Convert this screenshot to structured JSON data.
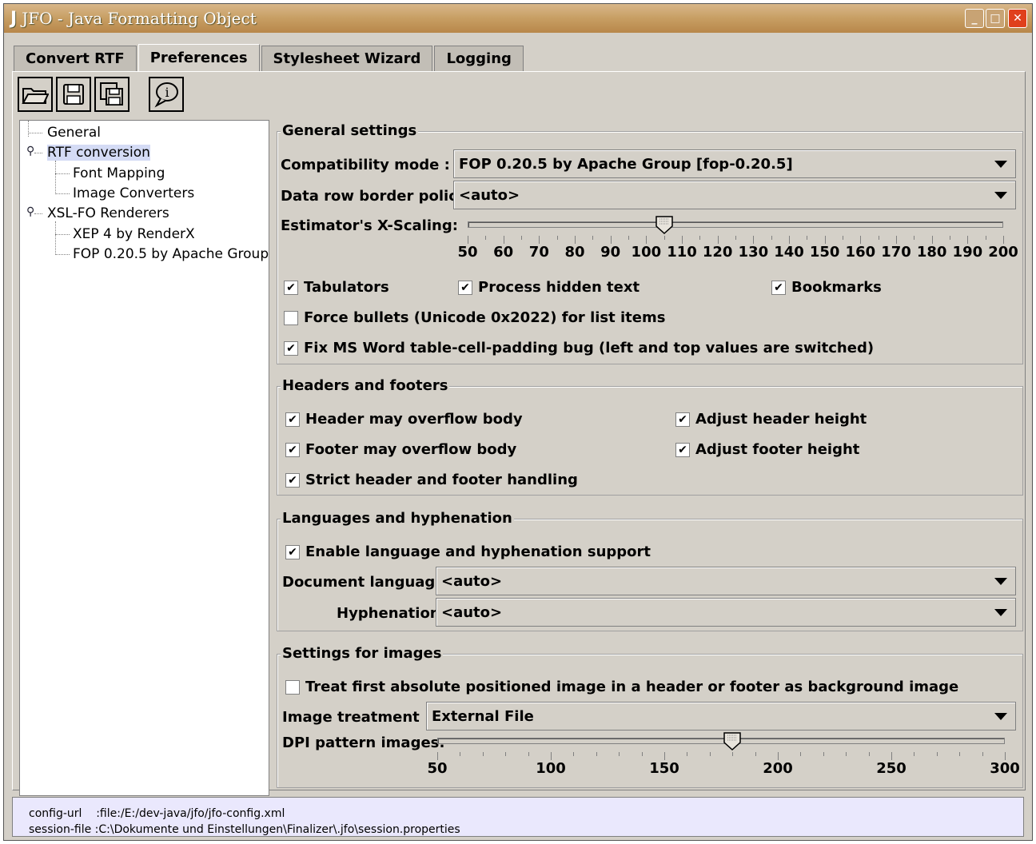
{
  "window": {
    "logo": "J",
    "title": "JFO - Java Formatting Object"
  },
  "tabs": [
    "Convert RTF",
    "Preferences",
    "Stylesheet Wizard",
    "Logging"
  ],
  "icons": {
    "open": "folder-open-icon",
    "save": "save-icon",
    "saveas": "save-as-icon",
    "info": "info-icon"
  },
  "tree": {
    "items": [
      "General",
      "RTF conversion",
      "Font Mapping",
      "Image Converters",
      "XSL-FO Renderers",
      "XEP 4 by RenderX",
      "FOP 0.20.5 by Apache Group"
    ]
  },
  "general": {
    "title": "General settings",
    "compat_label": "Compatibility mode :",
    "compat_value": "FOP 0.20.5 by Apache Group [fop-0.20.5]",
    "border_label": "Data row border policy :",
    "border_value": "<auto>",
    "scale_label": "Estimator's X-Scaling:",
    "scale_ticks": [
      "50",
      "60",
      "70",
      "80",
      "90",
      "100",
      "110",
      "120",
      "130",
      "140",
      "150",
      "160",
      "170",
      "180",
      "190",
      "200"
    ],
    "scale_value": 105,
    "tabulators": "Tabulators",
    "hidden": "Process hidden text",
    "bookmarks": "Bookmarks",
    "bullets": "Force bullets (Unicode 0x2022) for list items",
    "fixword": "Fix MS Word table-cell-padding bug (left and top values are switched)"
  },
  "headers": {
    "title": "Headers and footers",
    "hob": "Header may overflow body",
    "ahh": "Adjust header height",
    "fob": "Footer may overflow body",
    "afh": "Adjust footer height",
    "strict": "Strict header and footer handling"
  },
  "lang": {
    "title": "Languages and hyphenation",
    "enable": "Enable language and hyphenation support",
    "doc_label": "Document language :",
    "doc_value": "<auto>",
    "hyph_label": "Hyphenation :",
    "hyph_value": "<auto>"
  },
  "images": {
    "title": "Settings for images",
    "treat": "Treat first absolute positioned image in a header or footer as background image",
    "treat_label": "Image treatment :",
    "treat_value": "External File",
    "dpi_label": "DPI pattern images:",
    "dpi_ticks": [
      "50",
      "100",
      "150",
      "200",
      "250",
      "300"
    ],
    "dpi_value": 180
  },
  "status": {
    "config": "config-url    :file:/E:/dev-java/jfo/jfo-config.xml",
    "session": "session-file :C:\\Dokumente und Einstellungen\\Finalizer\\.jfo\\session.properties"
  }
}
